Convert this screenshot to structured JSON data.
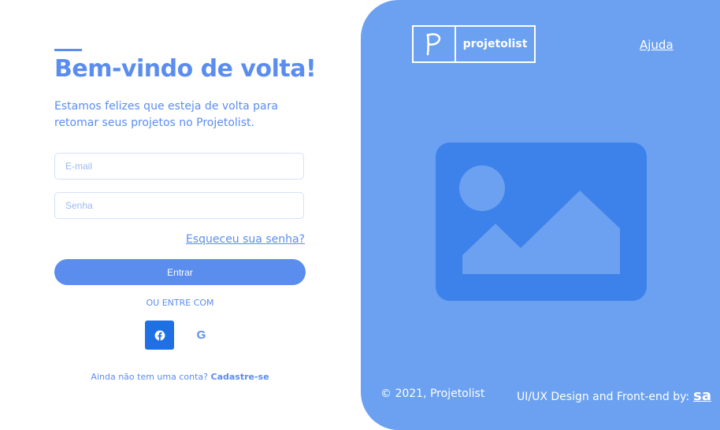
{
  "login": {
    "title": "Bem-vindo de volta!",
    "subtitle": "Estamos felizes que esteja de volta para retomar seus projetos no Projetolist.",
    "email_placeholder": "E-mail",
    "password_placeholder": "Senha",
    "forgot_label": "Esqueceu sua senha?",
    "submit_label": "Entrar",
    "or_label": "OU ENTRE COM",
    "social": [
      {
        "name": "facebook",
        "icon": "facebook-icon"
      },
      {
        "name": "google",
        "icon": "google-icon",
        "glyph": "G"
      }
    ],
    "signup_prompt": "Ainda não tem uma conta?",
    "signup_link": "Cadastre-se"
  },
  "panel": {
    "logo_letter": "P",
    "logo_name": "projetolist",
    "help_label": "Ajuda",
    "illustration_icon": "image-placeholder-icon",
    "copyright": "© 2021, Projetolist",
    "credit": "UI/UX Design and Front-end by:",
    "credit_mark": "sa"
  },
  "colors": {
    "accent": "#5b8def",
    "panel_bg": "#6ba1f0",
    "illustration_bg": "#3d82ea",
    "facebook_bg": "#1f6fe5"
  }
}
